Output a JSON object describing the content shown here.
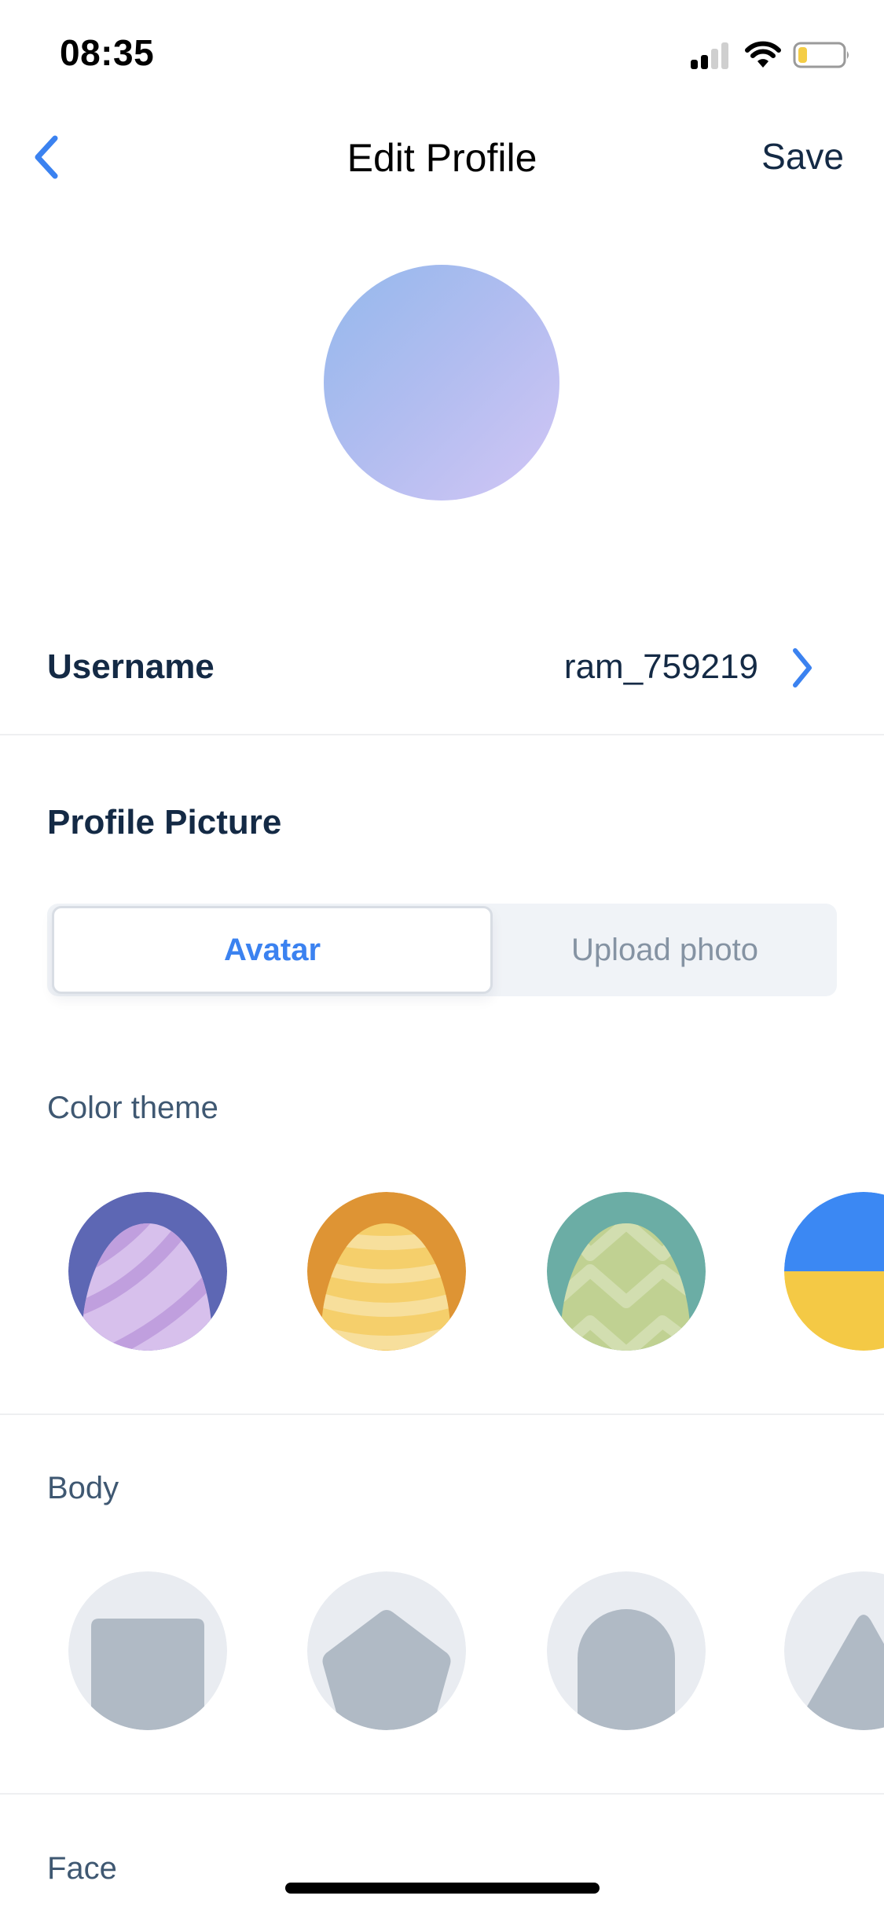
{
  "status_bar": {
    "time": "08:35",
    "signal_bars_filled": 2,
    "signal_bars_total": 4,
    "battery_level": 0.2,
    "battery_color": "#f4cd46",
    "icons": [
      "cellular-signal-icon",
      "wifi-icon",
      "battery-icon"
    ]
  },
  "nav": {
    "title": "Edit Profile",
    "save_label": "Save",
    "back_icon": "chevron-left-icon",
    "accent_color": "#3b82f0"
  },
  "avatar": {
    "gradient_from": "#94b8ec",
    "gradient_to": "#d2c6f5"
  },
  "username": {
    "label": "Username",
    "value": "ram_759219",
    "chevron_icon": "chevron-right-icon"
  },
  "profile_picture": {
    "title": "Profile Picture",
    "tabs": [
      {
        "label": "Avatar",
        "active": true
      },
      {
        "label": "Upload photo",
        "active": false
      }
    ]
  },
  "color_theme": {
    "label": "Color theme",
    "options": [
      {
        "name": "purple-stripes",
        "outer": "#5d67b4",
        "base": "#d7c0ec",
        "pattern": "#c09fde"
      },
      {
        "name": "orange-bands",
        "outer": "#de9434",
        "base": "#f5cf6b",
        "pattern": "#f7df9c"
      },
      {
        "name": "teal-zigzag",
        "outer": "#6badA5",
        "base": "#c0d192",
        "pattern": "#d2deb0"
      },
      {
        "name": "blue-yellow-split",
        "top": "#3b88f3",
        "bottom": "#f4c945"
      }
    ]
  },
  "body": {
    "label": "Body",
    "options": [
      {
        "name": "square-body"
      },
      {
        "name": "pentagon-body"
      },
      {
        "name": "arch-body"
      },
      {
        "name": "triangle-body"
      }
    ]
  },
  "face": {
    "label": "Face"
  }
}
